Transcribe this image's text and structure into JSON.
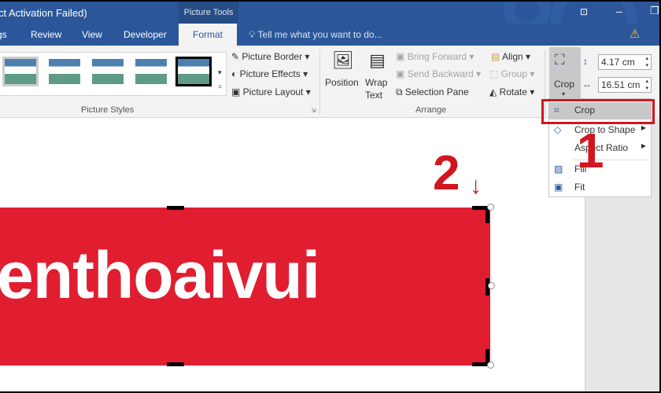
{
  "title_bar": {
    "title": "ct Activation Failed)",
    "context_tab": "Picture Tools",
    "buttons": [
      "ribbon-display-icon",
      "minimize-icon",
      "restore-icon"
    ]
  },
  "tabs": [
    {
      "label": "gs"
    },
    {
      "label": "Review"
    },
    {
      "label": "View"
    },
    {
      "label": "Developer"
    },
    {
      "label": "Format",
      "active": true
    }
  ],
  "tell_me": "Tell me what you want to do...",
  "picture_styles": {
    "group_label": "Picture Styles",
    "border": "Picture Border",
    "effects": "Picture Effects",
    "layout": "Picture Layout"
  },
  "arrange": {
    "group_label": "Arrange",
    "position": "Position",
    "wrap": "Wrap",
    "wrap2": "Text",
    "bring_forward": "Bring Forward",
    "send_backward": "Send Backward",
    "selection_pane": "Selection Pane",
    "align": "Align",
    "group": "Group",
    "rotate": "Rotate"
  },
  "size": {
    "crop": "Crop",
    "height": "4.17 cm",
    "width": "16.51 cm"
  },
  "crop_menu": [
    {
      "label": "Crop",
      "icon": "crop-icon"
    },
    {
      "label": "Crop to Shape",
      "icon": "crop-shape-icon",
      "submenu": true
    },
    {
      "label": "Aspect Ratio",
      "submenu": true
    },
    {
      "label": "Fill",
      "icon": "fill-icon"
    },
    {
      "label": "Fit",
      "icon": "fit-icon"
    }
  ],
  "image_text": "enthoaivui",
  "annotations": {
    "step1": "1",
    "step2": "2"
  },
  "colors": {
    "word_blue": "#2b579a",
    "image_red": "#e01e30",
    "annotation_red": "#d0161f"
  }
}
